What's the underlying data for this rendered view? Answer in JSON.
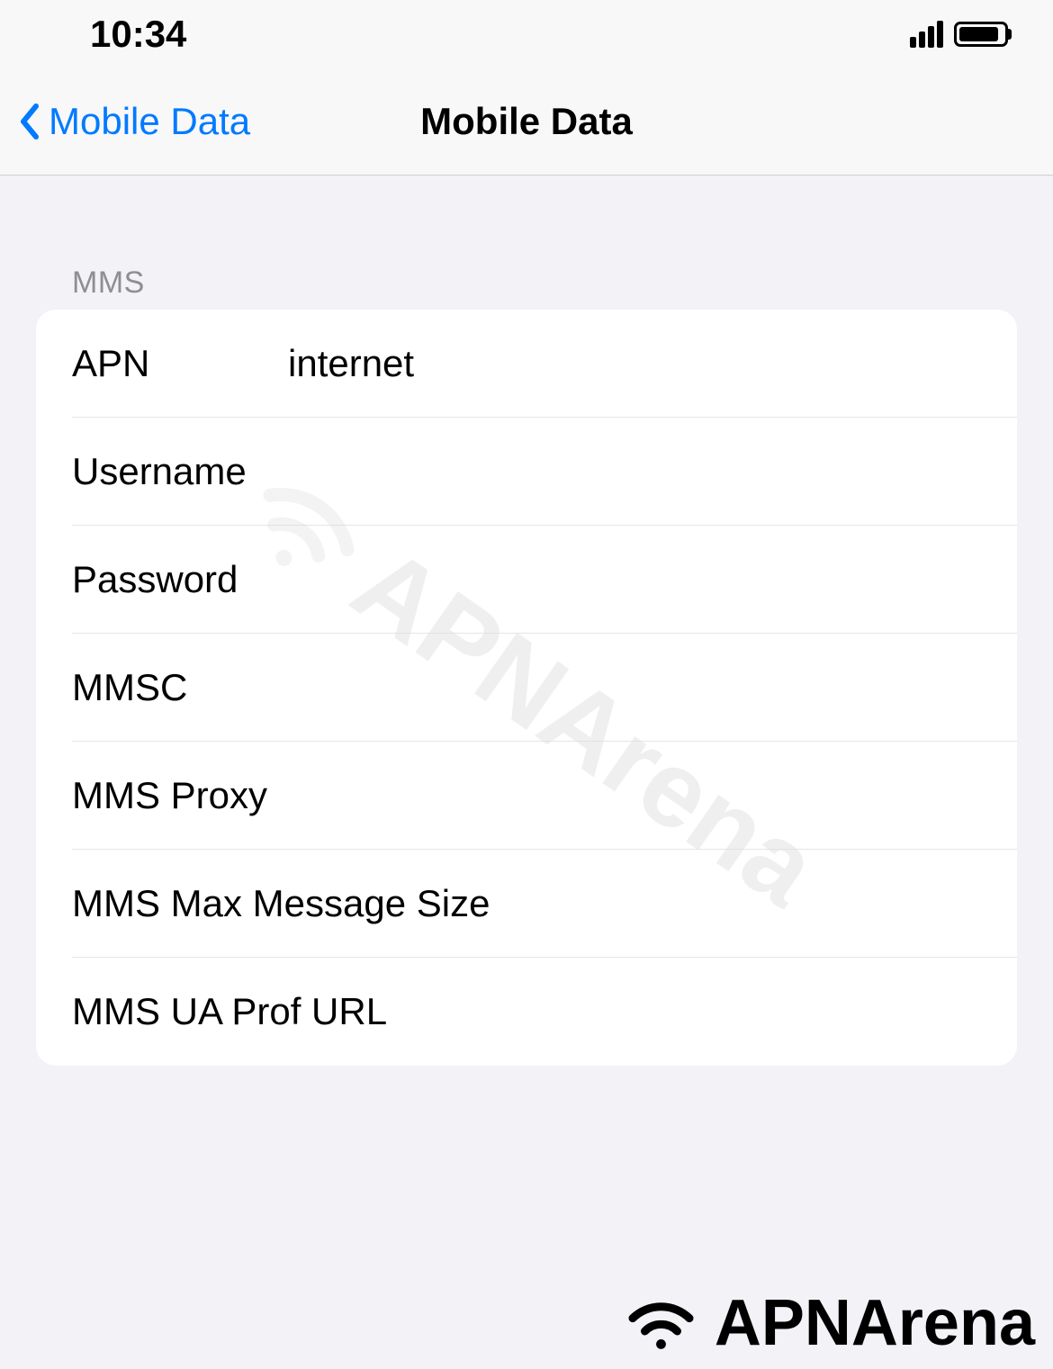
{
  "statusBar": {
    "time": "10:34"
  },
  "navBar": {
    "backLabel": "Mobile Data",
    "title": "Mobile Data"
  },
  "section": {
    "header": "MMS",
    "rows": [
      {
        "label": "APN",
        "value": "internet"
      },
      {
        "label": "Username",
        "value": ""
      },
      {
        "label": "Password",
        "value": ""
      },
      {
        "label": "MMSC",
        "value": ""
      },
      {
        "label": "MMS Proxy",
        "value": ""
      },
      {
        "label": "MMS Max Message Size",
        "value": ""
      },
      {
        "label": "MMS UA Prof URL",
        "value": ""
      }
    ]
  },
  "watermark": {
    "text": "APNArena"
  }
}
